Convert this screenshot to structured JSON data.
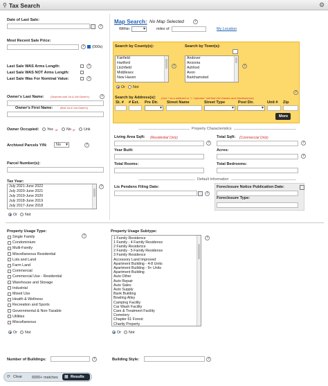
{
  "header": {
    "title": "Tax Search",
    "settings_icon": "gear-icon"
  },
  "left": {
    "date_last_sale": "Date of Last Sale:",
    "recent_sale_price": "Most Recent Sale Price:",
    "price_checkbox_label": "(000s)",
    "arms_length": "Last Sale WAS Arms Length:",
    "not_arms_length": "Last Sale WAS NOT Arms Length:",
    "nominal_value": "Last Sale Was For Nominal Value:",
    "owner_last": "Owner's Last Name:",
    "owner_last_hint": "(Searches both 1st & 2nd Owner's)",
    "owner_first": "Owner's First Name:",
    "owner_first_hint": "(Both 1st & 2nd Owner's)",
    "owner_occupied": "Owner Occupied:",
    "opt_yes": "Yes",
    "opt_or": "or",
    "opt_no": "No",
    "opt_unk": "Unk",
    "archived": "Archived Parcels Y/N:",
    "archived_value": "No",
    "parcel_numbers": "Parcel Number(s):",
    "tax_year": "Tax Year:",
    "tax_years": [
      "July 2021-June 2022",
      "July 2020-June 2021",
      "July 2019-June 2020",
      "July 2018-June 2019",
      "July 2017-June 2018"
    ],
    "or_label": "Or",
    "not_label": "Not"
  },
  "map": {
    "link": "Map Search:",
    "status": "No Map Selected",
    "within": "Within",
    "miles_of": "miles of",
    "my_location": "My Location"
  },
  "county": {
    "label": "Search by County(s):",
    "items": [
      "Fairfield",
      "Hartford",
      "Litchfield",
      "Middlesex",
      "New Haven"
    ],
    "or_label": "Or",
    "not_label": "Not"
  },
  "town": {
    "label": "Search by Town(s):",
    "items": [
      "Andover",
      "Ansonia",
      "Ashford",
      "Avon",
      "Barkhamsted"
    ]
  },
  "address": {
    "label": "Search by Address(s):",
    "hint": "(Use * as a wildcard or \"= \"operator\" will find Old Garden and Gardenbrook)",
    "cols": [
      "St. #",
      "# Est.",
      "Pre Dir.",
      "Street Name",
      "Street Type",
      "Post Dir.",
      "Unit #",
      "Zip"
    ],
    "more": "More"
  },
  "property": {
    "header": "Property Characteristics",
    "living_area": "Living Area Sqft:",
    "living_hint": "(Residential Only)",
    "total_sqft": "Total Sqft:",
    "total_hint": "(Commercial Only)",
    "year_built": "Year Built:",
    "acres": "Acres:",
    "total_rooms": "Total Rooms:",
    "total_bedrooms": "Total Bedrooms:"
  },
  "default_info": {
    "header": "Default Information",
    "lis_pendens": "Lis Pendens Filing Date:",
    "foreclosure_date": "Foreclosure Notice Publication Date:",
    "foreclosure_type": "Foreclosure Type:"
  },
  "usage": {
    "type_label": "Property Usage Type:",
    "types": [
      "Single Family",
      "Condominium",
      "Multi-Family",
      "Miscellaneous Residential",
      "Lots and Land",
      "Farm Land",
      "Commercial",
      "Commercial Use - Residential",
      "Warehouse and Storage",
      "Industrial",
      "Mixed Use",
      "Health & Wellness",
      "Recreation and Sports",
      "Governmental & Non-Taxable",
      "Utilities",
      "Miscellaneous"
    ],
    "subtype_label": "Property Usage Subtype:",
    "subtypes": [
      "1 Family Residence",
      "1 Family - 4 Family Residence",
      "2 Family Residence",
      "2 Family - 5 Family Residence",
      "3 Family Residence",
      "Accessory Land Improved",
      "Apartment Building - 4-8 Units",
      "Apartment Building - 9+ Units",
      "Apartment Building",
      "Auto Other",
      "Auto Repair",
      "Auto Sales",
      "Auto Supply",
      "Bank Building",
      "Bowling Alley",
      "Camping Facility",
      "Car Wash Facility",
      "Care & Treatment Facility",
      "Cemetery",
      "Chapter 61 Forest",
      "Charity Property"
    ],
    "or_label": "Or",
    "not_label": "Not"
  },
  "bottom": {
    "num_buildings": "Number of Buildings:",
    "building_style": "Building Style:"
  },
  "footer": {
    "clear": "Clear",
    "matches": "5000+ matches",
    "results": "Results"
  }
}
